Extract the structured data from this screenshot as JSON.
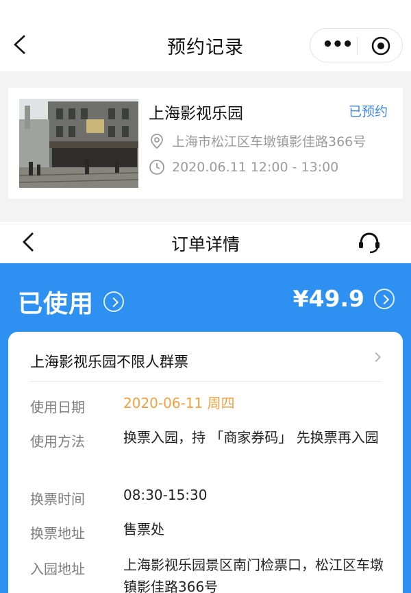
{
  "top_bar": {
    "title": "预约记录",
    "more_glyph": "•••",
    "back_icon": "chevron-left-icon",
    "capsule_icon": "target-icon"
  },
  "reservation": {
    "name": "上海影视乐园",
    "status": "已预约",
    "address": "上海市松江区车墩镇影佳路366号",
    "time": "2020.06.11 12:00 - 13:00",
    "status_color": "#3b86e8"
  },
  "order_bar": {
    "title": "订单详情",
    "support_icon": "headset-icon"
  },
  "order": {
    "status": "已使用",
    "price": "¥49.9",
    "ticket_name": "上海影视乐园不限人群票",
    "accent": "#2e90f0",
    "date_color": "#f0a041"
  },
  "details": [
    {
      "label": "使用日期",
      "value": "2020-06-11 周四"
    },
    {
      "label": "使用方法",
      "value": "换票入园，持 「商家券码」 先换票再入园"
    },
    {
      "label": "换票时间",
      "value": "08:30-15:30"
    },
    {
      "label": "换票地址",
      "value": "售票处"
    },
    {
      "label": "入园地址",
      "value": "上海影视乐园景区南门检票口，松江区车墩镇影佳路366号"
    }
  ]
}
